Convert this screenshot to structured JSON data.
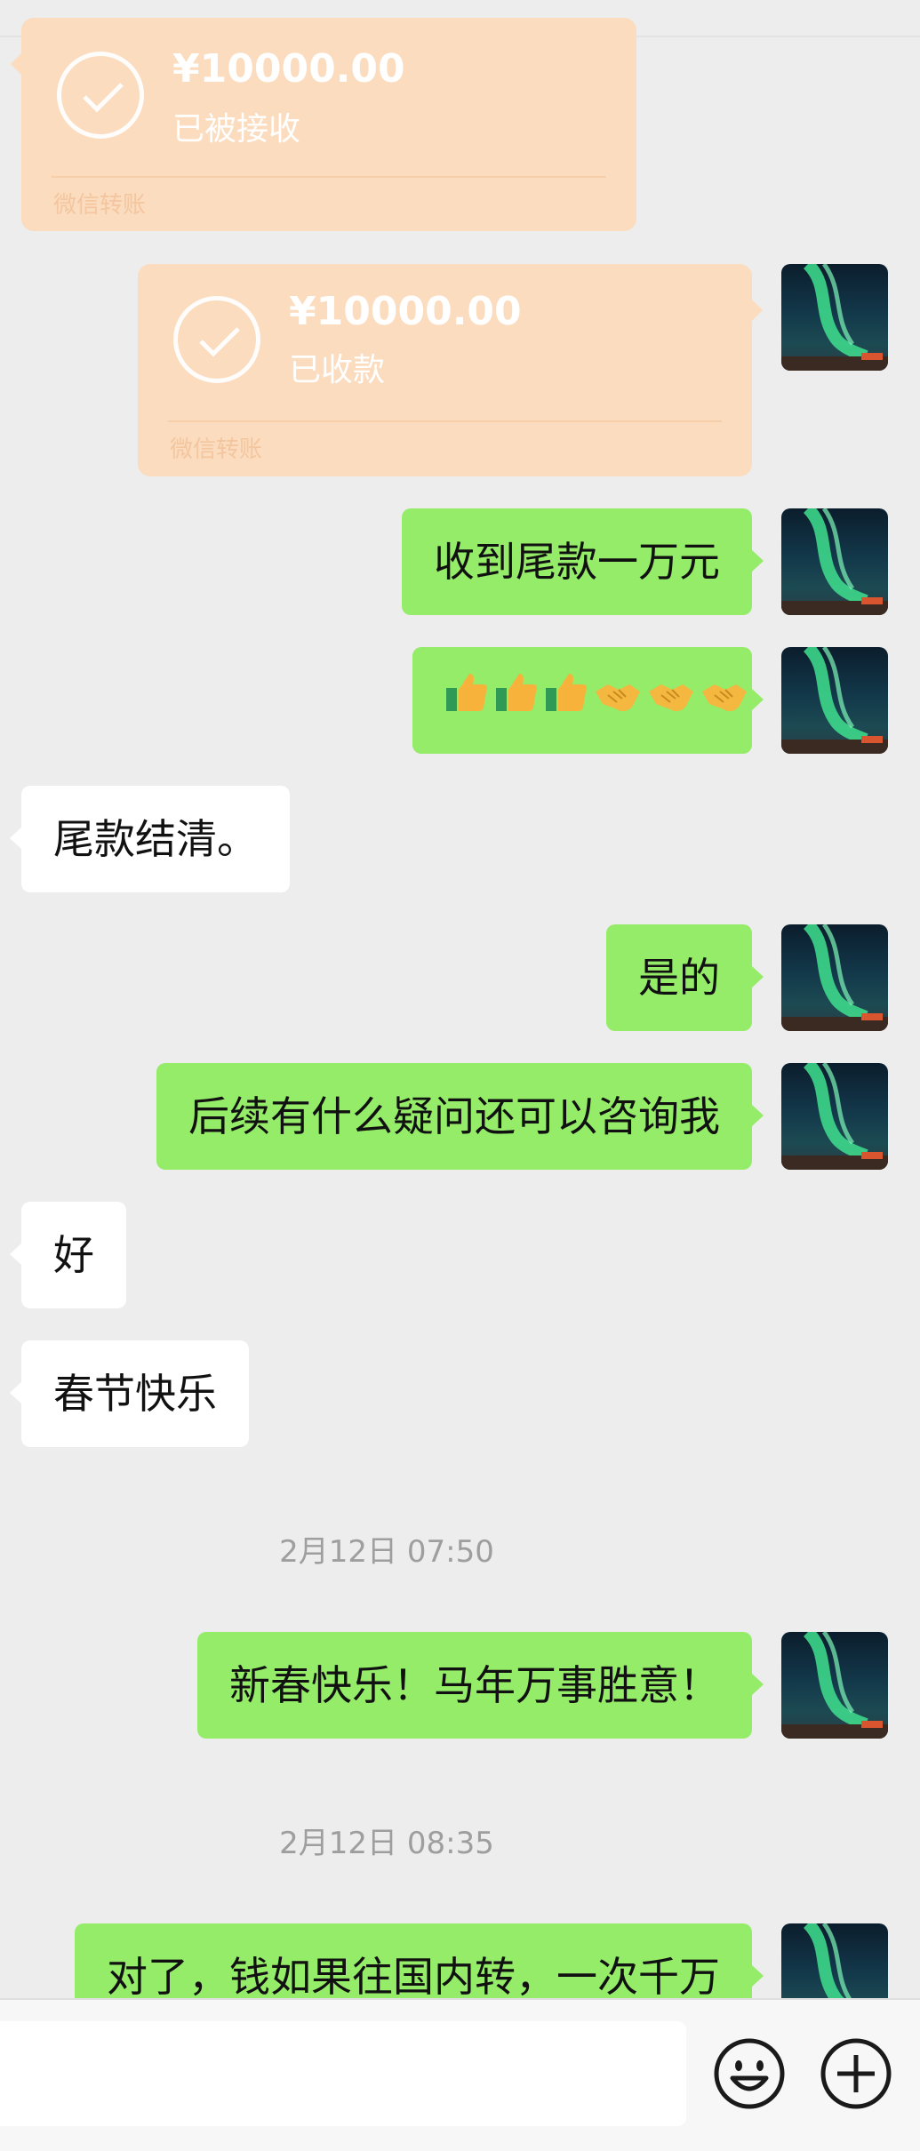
{
  "transfers": [
    {
      "amount": "¥10000.00",
      "status": "已被接收",
      "footer": "微信转账"
    },
    {
      "amount": "¥10000.00",
      "status": "已收款",
      "footer": "微信转账"
    }
  ],
  "messages": {
    "m1": "收到尾款一万元",
    "m3": "尾款结清。",
    "m4": "是的",
    "m5": "后续有什么疑问还可以咨询我",
    "m6": "好",
    "m7": "春节快乐",
    "m8": "新春快乐！马年万事胜意！",
    "m9": "对了，钱如果往国内转，一次千万"
  },
  "emoji_row": [
    "thumbs-up",
    "thumbs-up",
    "thumbs-up",
    "handshake",
    "handshake",
    "handshake"
  ],
  "timestamps": {
    "t1": "2月12日 07:50",
    "t2": "2月12日 08:35"
  },
  "colors": {
    "outgoing_bubble": "#95ec69",
    "incoming_bubble": "#ffffff",
    "transfer_card": "#fbdcbe",
    "background": "#ededed"
  },
  "input": {
    "placeholder": ""
  }
}
